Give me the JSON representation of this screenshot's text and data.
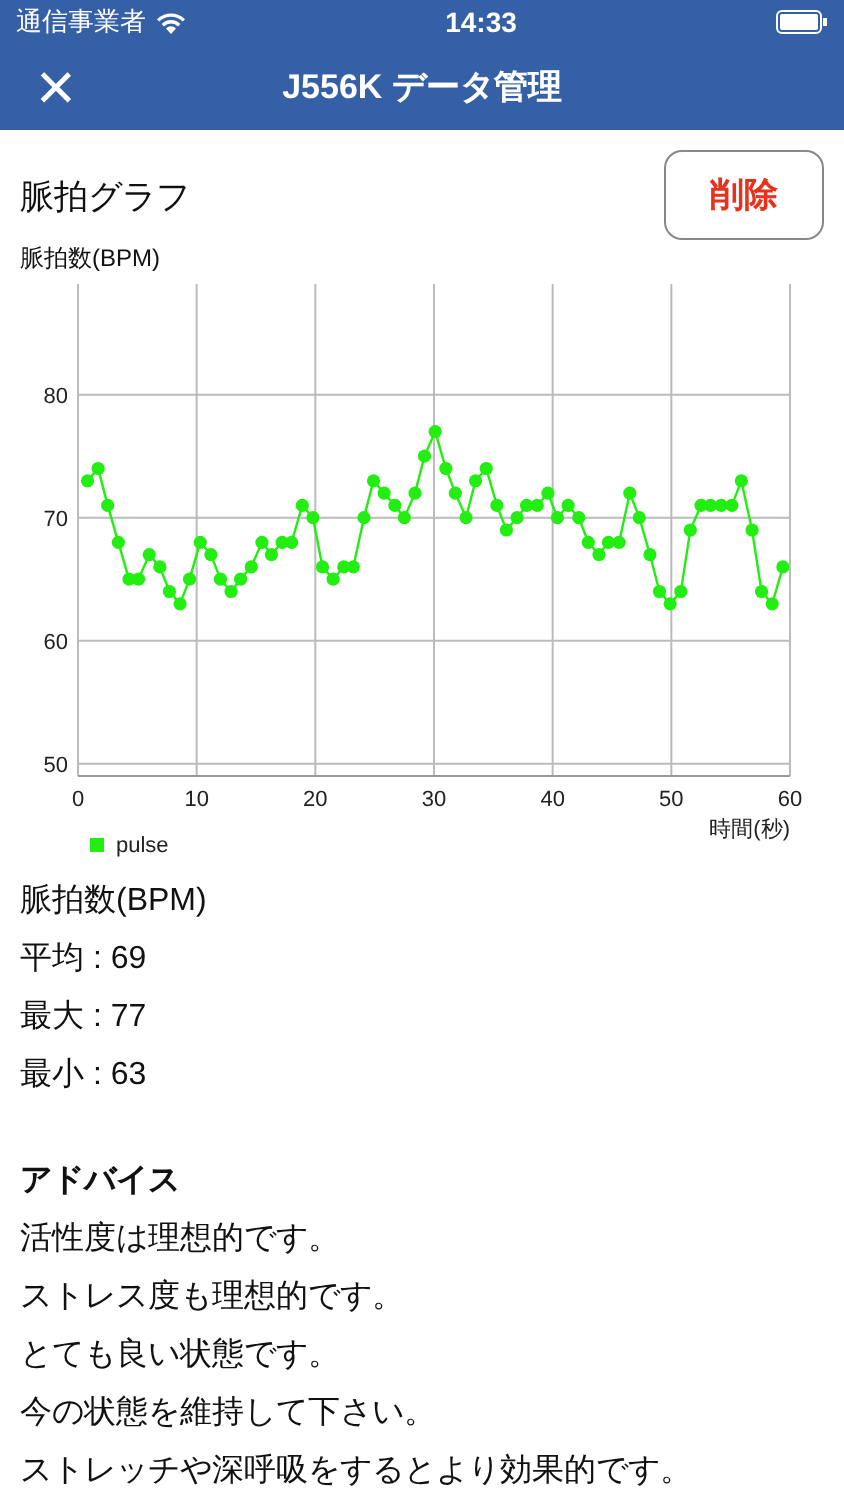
{
  "status_bar": {
    "carrier": "通信事業者",
    "time": "14:33"
  },
  "nav": {
    "close": "×",
    "title": "J556K データ管理"
  },
  "graph_section": {
    "title": "脈拍グラフ",
    "delete_button": "削除",
    "chart_data": {
      "type": "line",
      "grid": true,
      "xlabel": "時間(秒)",
      "ylabel": "脈拍数(BPM)",
      "xlim": [
        0,
        60
      ],
      "ylim": [
        49,
        89
      ],
      "xticks": [
        0,
        10,
        20,
        30,
        40,
        50,
        60
      ],
      "yticks": [
        50,
        60,
        70,
        80
      ],
      "x": [
        0.8,
        1.7,
        2.5,
        3.4,
        4.3,
        5.1,
        6.0,
        6.9,
        7.7,
        8.6,
        9.4,
        10.3,
        11.2,
        12.0,
        12.9,
        13.7,
        14.6,
        15.5,
        16.3,
        17.2,
        18.0,
        18.9,
        19.8,
        20.6,
        21.5,
        22.4,
        23.2,
        24.1,
        24.9,
        25.8,
        26.7,
        27.5,
        28.4,
        29.2,
        30.1,
        31.0,
        31.8,
        32.7,
        33.5,
        34.4,
        35.3,
        36.1,
        37.0,
        37.8,
        38.7,
        39.6,
        40.4,
        41.3,
        42.2,
        43.0,
        43.9,
        44.7,
        45.6,
        46.5,
        47.3,
        48.2,
        49.0,
        49.9,
        50.8,
        51.6,
        52.5,
        53.3,
        54.2,
        55.1,
        55.9,
        56.8,
        57.6,
        58.5,
        59.4
      ],
      "series": [
        {
          "name": "pulse",
          "color": "#22ee11",
          "marker": "circle",
          "values": [
            73,
            74,
            71,
            68,
            65,
            65,
            67,
            66,
            64,
            63,
            65,
            68,
            67,
            65,
            64,
            65,
            66,
            68,
            67,
            68,
            68,
            71,
            70,
            66,
            65,
            66,
            66,
            70,
            73,
            72,
            71,
            70,
            72,
            75,
            77,
            74,
            72,
            70,
            73,
            74,
            71,
            69,
            70,
            71,
            71,
            72,
            70,
            71,
            70,
            68,
            67,
            68,
            68,
            72,
            70,
            67,
            64,
            63,
            64,
            69,
            71,
            71,
            71,
            71,
            73,
            69,
            64,
            63,
            66
          ]
        }
      ]
    }
  },
  "stats": {
    "heading": "脈拍数(BPM)",
    "lines": [
      "平均 : 69",
      "最大 : 77",
      "最小 : 63"
    ]
  },
  "advice": {
    "heading": "アドバイス",
    "lines": [
      "活性度は理想的です。",
      "ストレス度も理想的です。",
      "とても良い状態です。",
      "今の状態を維持して下さい。",
      "ストレッチや深呼吸をするとより効果的です。"
    ]
  }
}
